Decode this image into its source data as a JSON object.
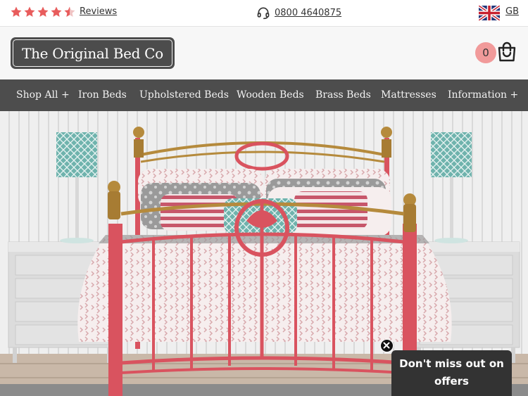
{
  "topbar": {
    "rating_stars": 4.5,
    "star_color": "#e85c5c",
    "reviews_label": "Reviews",
    "phone": "0800 4640875",
    "region": "GB"
  },
  "header": {
    "logo_text": "The Original Bed Co",
    "cart_count": "0",
    "cart_badge_color": "#f19a9a"
  },
  "nav": {
    "items": [
      {
        "label": "Shop All +"
      },
      {
        "label": "Iron Beds"
      },
      {
        "label": "Upholstered Beds"
      },
      {
        "label": "Wooden Beds"
      },
      {
        "label": "Brass Beds"
      },
      {
        "label": "Mattresses"
      },
      {
        "label": "Information +"
      }
    ]
  },
  "hero": {
    "bed_color": "#d9535f",
    "brass_color": "#b58a3c",
    "lamp_color": "#6fb3ad"
  },
  "promo": {
    "line1": "Don't miss out on",
    "line2": "offers"
  }
}
